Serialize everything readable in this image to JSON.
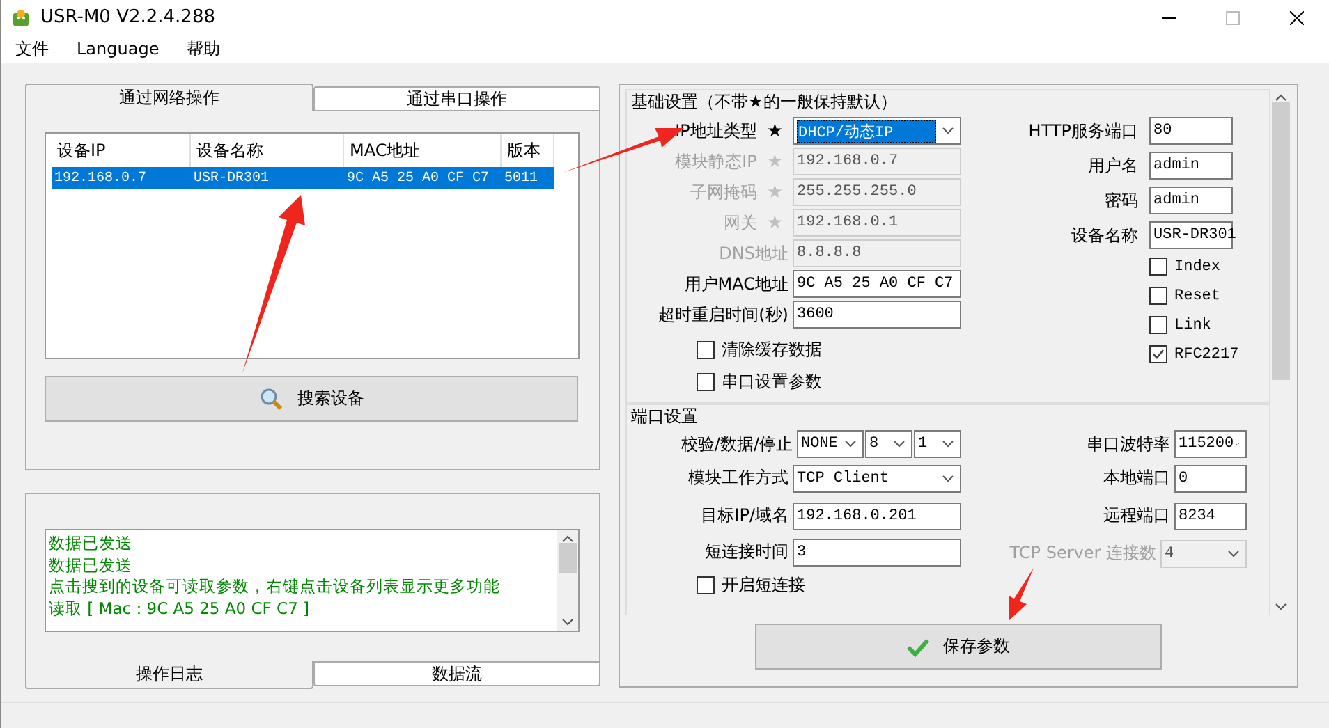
{
  "window": {
    "title": "USR-M0 V2.2.4.288"
  },
  "menu": [
    "文件",
    "Language",
    "帮助"
  ],
  "device_tabs": [
    {
      "label": "通过网络操作",
      "selected": true
    },
    {
      "label": "通过串口操作",
      "selected": false
    }
  ],
  "device_table": {
    "columns": [
      "设备IP",
      "设备名称",
      "MAC地址",
      "版本"
    ],
    "rows": [
      {
        "cells": [
          "192.168.0.7",
          "USR-DR301",
          "9C A5 25 A0 CF C7",
          "5011"
        ],
        "selected": true
      }
    ]
  },
  "search_button": "搜索设备",
  "log": {
    "lines": [
      "数据已发送",
      "数据已发送",
      "点击搜到的设备可读取参数，右键点击设备列表显示更多功能",
      "读取 [ Mac : 9C A5 25 A0 CF C7 ]"
    ]
  },
  "log_tabs": [
    {
      "label": "操作日志",
      "selected": true
    },
    {
      "label": "数据流",
      "selected": false
    }
  ],
  "basic_settings": {
    "title": "基础设置（不带★的一般保持默认）",
    "left_fields": [
      {
        "label": "IP地址类型",
        "star": "★",
        "kind": "select",
        "value": "DHCP/动态IP",
        "disabled": false,
        "highlighted": true
      },
      {
        "label": "模块静态IP",
        "star": "★",
        "kind": "input",
        "value": "192.168.0.7",
        "disabled": true
      },
      {
        "label": "子网掩码",
        "star": "★",
        "kind": "input",
        "value": "255.255.255.0",
        "disabled": true
      },
      {
        "label": "网关",
        "star": "★",
        "kind": "input",
        "value": "192.168.0.1",
        "disabled": true
      },
      {
        "label": "DNS地址",
        "kind": "input",
        "value": "8.8.8.8",
        "disabled": true
      },
      {
        "label": "用户MAC地址",
        "kind": "input",
        "value": "9C A5 25 A0 CF C7",
        "disabled": false
      },
      {
        "label": "超时重启时间(秒)",
        "kind": "input",
        "value": "3600",
        "disabled": false
      }
    ],
    "left_checkboxes": [
      {
        "label": "清除缓存数据",
        "checked": false
      },
      {
        "label": "串口设置参数",
        "checked": false
      }
    ],
    "right_fields": [
      {
        "label": "HTTP服务端口",
        "value": "80"
      },
      {
        "label": "用户名",
        "value": "admin"
      },
      {
        "label": "密码",
        "value": "admin"
      },
      {
        "label": "设备名称",
        "value": "USR-DR301"
      }
    ],
    "right_checkboxes": [
      {
        "label": "Index",
        "checked": false
      },
      {
        "label": "Reset",
        "checked": false
      },
      {
        "label": "Link",
        "checked": false
      },
      {
        "label": "RFC2217",
        "checked": true
      }
    ]
  },
  "port_settings": {
    "title": "端口设置",
    "left_fields": [
      {
        "label": "校验/数据/停止",
        "kind": "selects",
        "values": [
          "NONE",
          "8",
          "1"
        ]
      },
      {
        "label": "模块工作方式",
        "kind": "select",
        "values": [
          "TCP Client"
        ]
      },
      {
        "label": "目标IP/域名",
        "kind": "input",
        "values": [
          "192.168.0.201"
        ]
      },
      {
        "label": "短连接时间",
        "kind": "input",
        "values": [
          "3"
        ]
      }
    ],
    "right_fields": [
      {
        "label": "串口波特率",
        "kind": "select",
        "value": "115200",
        "disabled": false
      },
      {
        "label": "本地端口",
        "kind": "input",
        "value": "0",
        "disabled": false
      },
      {
        "label": "远程端口",
        "kind": "input",
        "value": "8234",
        "disabled": false
      },
      {
        "label": "TCP Server 连接数",
        "kind": "select",
        "value": "4",
        "disabled": true
      }
    ],
    "checkboxes": [
      {
        "label": "开启短连接",
        "checked": false
      }
    ]
  },
  "save_button": "保存参数"
}
